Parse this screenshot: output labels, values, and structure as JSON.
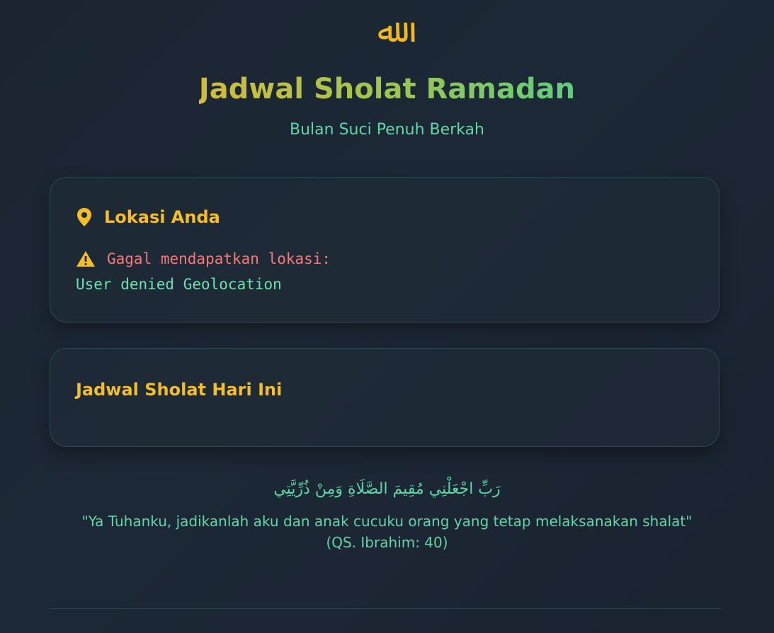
{
  "header": {
    "logo_text": "ﷲ",
    "title": "Jadwal Sholat Ramadan",
    "subtitle": "Bulan Suci Penuh Berkah"
  },
  "location_card": {
    "heading": "Lokasi Anda",
    "icon": "location-pin-icon",
    "error_icon": "warning-icon",
    "error_message": "Gagal mendapatkan lokasi:",
    "error_detail": "User denied Geolocation"
  },
  "schedule_card": {
    "heading": "Jadwal Sholat Hari Ini"
  },
  "verse": {
    "arabic": "رَبِّ اجْعَلْنِي مُقِيمَ الصَّلَاةِ وَمِنْ ذُرِّيَّتِي",
    "translation": "\"Ya Tuhanku, jadikanlah aku dan anak cucuku orang yang tetap melaksanakan shalat\"",
    "reference": "(QS. Ibrahim: 40)"
  },
  "colors": {
    "accent_gold": "#f3be2a",
    "accent_green": "#5fd7a6",
    "error_red": "#f27a7a",
    "background": "#1d2836"
  }
}
